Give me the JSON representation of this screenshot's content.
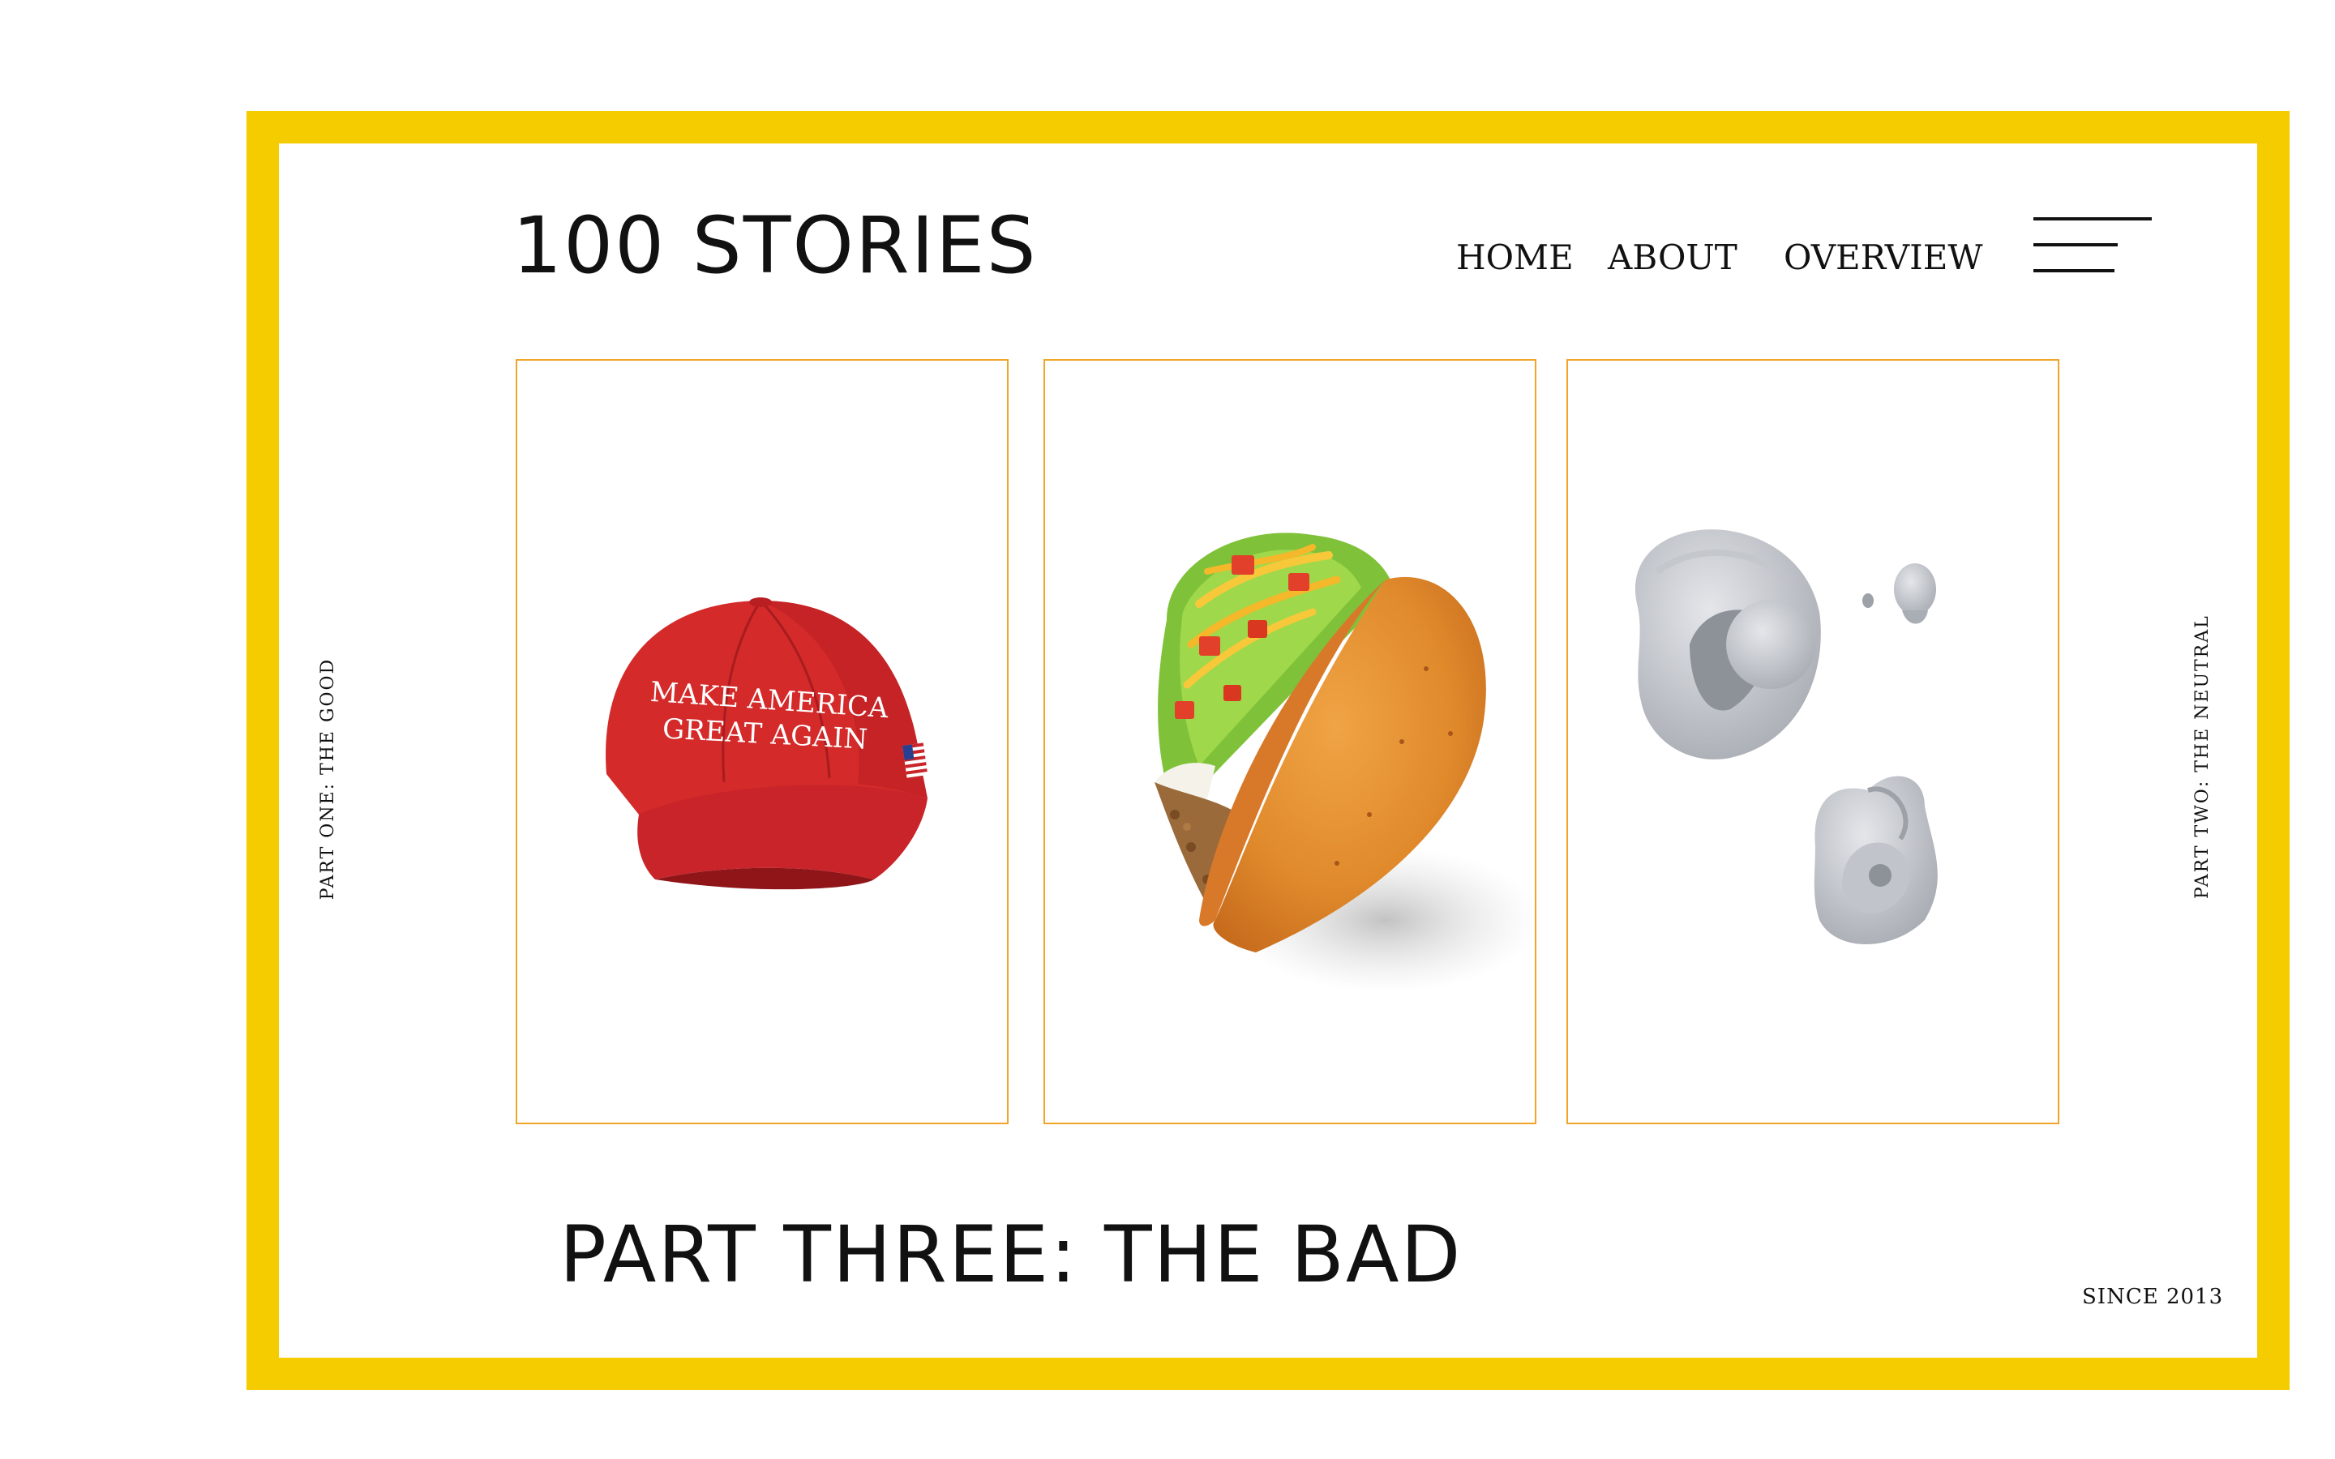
{
  "header": {
    "brand": "100 STORIES",
    "nav": {
      "home": "HOME",
      "about": "ABOUT",
      "overview": "OVERVIEW"
    },
    "menu_icon": "hamburger-menu-icon"
  },
  "cards": [
    {
      "image": "red-cap-image",
      "cap_text_line1": "MAKE AMERICA",
      "cap_text_line2": "GREAT AGAIN"
    },
    {
      "image": "taco-image"
    },
    {
      "image": "clay-sculpture-image"
    }
  ],
  "side_labels": {
    "left": "PART ONE: THE GOOD",
    "right": "PART TWO: THE NEUTRAL"
  },
  "main": {
    "part_title": "PART THREE: THE BAD"
  },
  "footer": {
    "since": "SINCE 2013"
  },
  "colors": {
    "frame": "#f5cc00",
    "card_border": "#f0a52a",
    "text": "#111111",
    "cap_red": "#d42a2a"
  }
}
